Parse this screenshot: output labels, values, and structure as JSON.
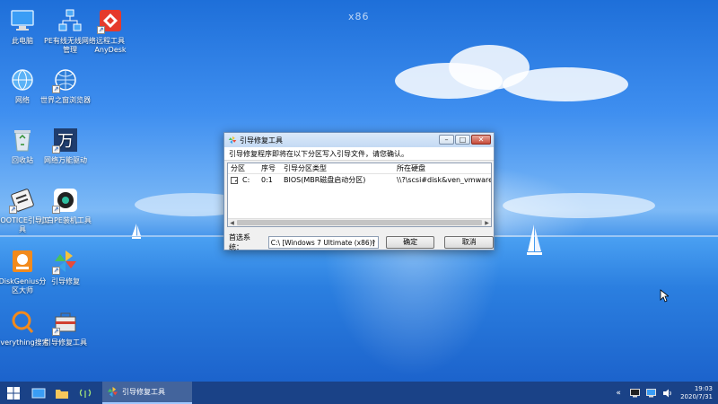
{
  "desktop": {
    "watermark": "x86",
    "icons": [
      {
        "label": "此电脑"
      },
      {
        "label": "PE有线无线网络管理"
      },
      {
        "label": "远程工具AnyDesk"
      },
      {
        "label": "网络"
      },
      {
        "label": "世界之窗浏览器"
      },
      {
        "label": "回收站"
      },
      {
        "label": "网络万能驱动"
      },
      {
        "label": "BOOTICE引导工具"
      },
      {
        "label": "小白PE装机工具"
      },
      {
        "label": "DiskGenius分区大师"
      },
      {
        "label": "引导修复"
      },
      {
        "label": "Everything搜索"
      },
      {
        "label": "引导修复工具"
      }
    ]
  },
  "dialog": {
    "title": "引导修复工具",
    "message": "引导修复程序即将在以下分区写入引导文件，请您确认。",
    "columns": [
      "分区",
      "序号",
      "引导分区类型",
      "所在硬盘"
    ],
    "rows": [
      {
        "partition": "C:",
        "checked": true,
        "index": "0:1",
        "type": "BIOS(MBR磁盘启动分区)",
        "disk": "\\\\?\\scsi#disk&ven_vmware_&"
      }
    ],
    "select_label": "首选系统：",
    "select_value": "C:\\ [Windows 7 Ultimate (x86)]",
    "ok_label": "确定",
    "cancel_label": "取消"
  },
  "taskbar": {
    "app_label": "引导修复工具",
    "time": "19:03",
    "date": "2020/7/31"
  },
  "colors": {
    "sky": "#3f8ff0",
    "taskbar": "#1a4082",
    "titlebar": "#c4daf4"
  }
}
